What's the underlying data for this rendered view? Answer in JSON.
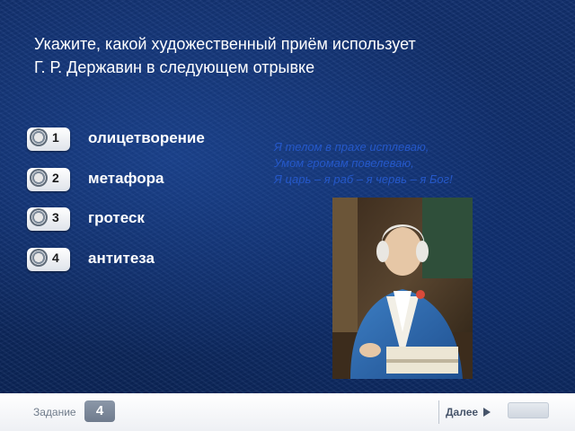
{
  "question": {
    "line1": "Укажите, какой художественный приём использует",
    "line2": "Г. Р. Державин в следующем отрывке"
  },
  "options": [
    {
      "num": "1",
      "label": "олицетворение"
    },
    {
      "num": "2",
      "label": "метафора"
    },
    {
      "num": "3",
      "label": "гротеск"
    },
    {
      "num": "4",
      "label": "антитеза"
    }
  ],
  "quote": {
    "line1": "Я телом в прахе истлеваю,",
    "line2": "Умом громам повелеваю,",
    "line3": "Я царь – я раб – я червь – я Бог!"
  },
  "portrait": {
    "icon": "portrait-image"
  },
  "footer": {
    "task_label": "Задание",
    "task_number": "4",
    "next_label": "Далее"
  },
  "colors": {
    "background": "#0f2c68",
    "quote_text": "#2558c9",
    "footer": "#f3f4f7",
    "task_badge": "#7b8799"
  }
}
